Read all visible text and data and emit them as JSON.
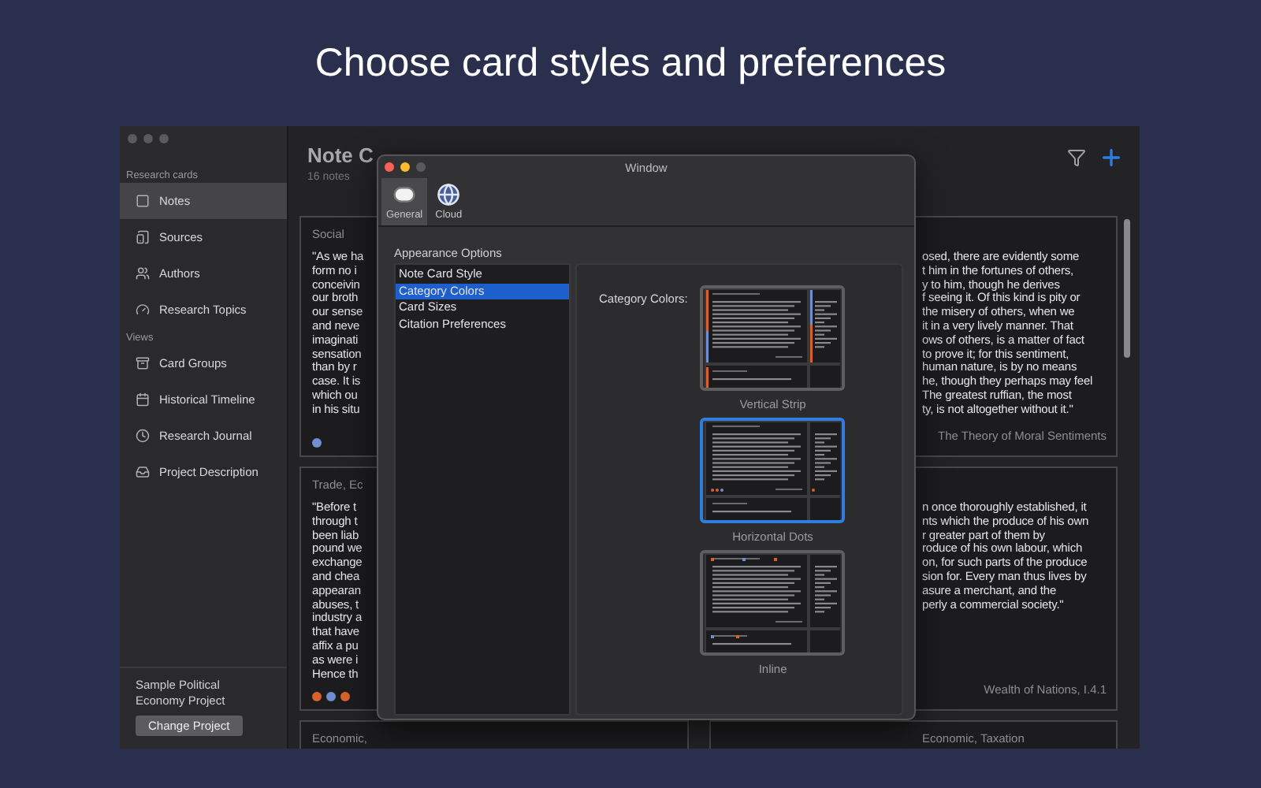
{
  "headline": "Choose card styles and preferences",
  "sidebar": {
    "sections": [
      {
        "title": "Research cards",
        "items": [
          {
            "label": "Notes",
            "selected": true
          },
          {
            "label": "Sources",
            "selected": false
          },
          {
            "label": "Authors",
            "selected": false
          },
          {
            "label": "Research Topics",
            "selected": false
          }
        ]
      },
      {
        "title": "Views",
        "items": [
          {
            "label": "Card Groups",
            "selected": false
          },
          {
            "label": "Historical Timeline",
            "selected": false
          },
          {
            "label": "Research Journal",
            "selected": false
          },
          {
            "label": "Project Description",
            "selected": false
          }
        ]
      }
    ],
    "project_name": "Sample Political Economy Project",
    "change_button": "Change Project"
  },
  "main": {
    "title": "Note C",
    "count": "16 notes",
    "card_columns": [
      {
        "cards": [
          {
            "category": "Social",
            "lines": [
              "\"As we ha",
              "form no i",
              "conceivin",
              "our broth",
              "our sense",
              "and neve",
              "imaginati",
              "sensation",
              "than by r",
              "case. It is",
              "which ou",
              "in his situ"
            ],
            "dots": [
              {
                "color": "#6f8fd0"
              }
            ]
          },
          {
            "category": "Trade, Ec",
            "lines": [
              "\"Before t",
              "through t",
              "been liab",
              "pound we",
              "exchange",
              "and chea",
              "appearan",
              "abuses, t",
              "industry a",
              "that have",
              "affix a pu",
              "as were i",
              "Hence th"
            ],
            "dots": [
              {
                "color": "#d9622b"
              },
              {
                "color": "#6f8fd0"
              },
              {
                "color": "#d9622b"
              }
            ]
          },
          {
            "category": "Economic,"
          }
        ]
      },
      {
        "cards": [
          {
            "lines": [
              "osed, there are evidently some",
              "t him in the fortunes of others,",
              "y to him, though he derives",
              "f seeing it. Of this kind is pity or",
              "the misery of others, when we",
              "it in a very lively manner. That",
              "ows of others, is a matter of fact",
              "to prove it; for this sentiment,",
              "human nature, is by no means",
              "he, though they perhaps may feel",
              "The greatest ruffian, the most",
              "ty, is not altogether without it.\""
            ],
            "source": "The Theory of Moral Sentiments"
          },
          {
            "lines": [
              "n once thoroughly established, it",
              "nts which the produce of his own",
              "r greater part of them by",
              "roduce of his own labour, which",
              "on, for such parts of the produce",
              "sion for. Every man thus lives by",
              "asure a merchant, and the",
              "perly a commercial society.\""
            ],
            "source": "Wealth of Nations, I.4.1"
          },
          {
            "category": "Economic, Taxation"
          }
        ]
      }
    ]
  },
  "dialog": {
    "title": "Window",
    "toolbar": [
      {
        "label": "General",
        "selected": true
      },
      {
        "label": "Cloud",
        "selected": false
      }
    ],
    "section_label": "Appearance Options",
    "options": [
      {
        "label": "Note Card Style",
        "selected": false
      },
      {
        "label": "Category Colors",
        "selected": true
      },
      {
        "label": "Card Sizes",
        "selected": false
      },
      {
        "label": "Citation Preferences",
        "selected": false
      }
    ],
    "panel_label": "Category Colors:",
    "styles": [
      {
        "kind": "strip",
        "label": "Vertical Strip",
        "selected": false
      },
      {
        "kind": "dots",
        "label": "Horizontal Dots",
        "selected": true
      },
      {
        "kind": "inline",
        "label": "Inline",
        "selected": false
      }
    ]
  }
}
